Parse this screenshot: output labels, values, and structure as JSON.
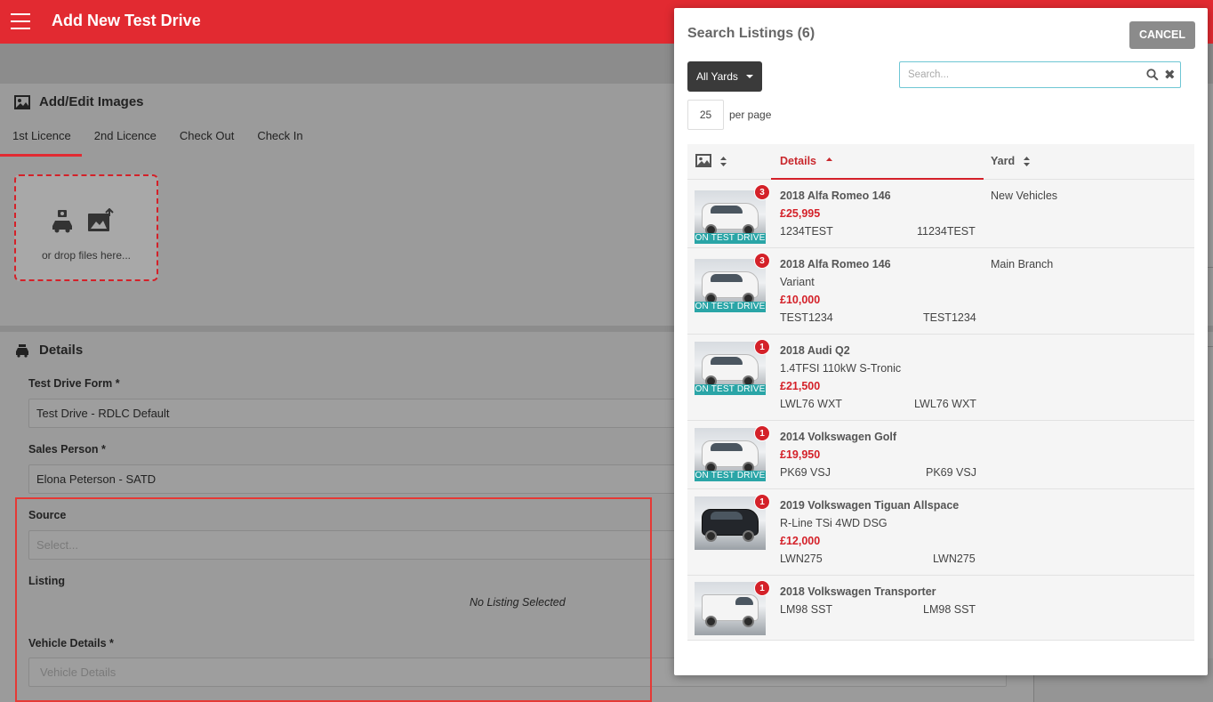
{
  "app": {
    "title": "Add New Test Drive"
  },
  "images_card": {
    "title": "Add/Edit Images",
    "tabs": [
      "1st Licence",
      "2nd Licence",
      "Check Out",
      "Check In"
    ],
    "dropzone_text": "or drop files here..."
  },
  "details_card": {
    "title": "Details",
    "form_label": "Test Drive Form *",
    "form_value": "Test Drive - RDLC Default",
    "sales_label": "Sales Person *",
    "sales_value": "Elona Peterson - SATD",
    "source_label": "Source",
    "source_placeholder": "Select...",
    "listing_label": "Listing",
    "listing_value": "No Listing Selected",
    "vehicle_label": "Vehicle Details *",
    "vehicle_placeholder": "Vehicle Details"
  },
  "modal": {
    "title": "Search Listings (6)",
    "cancel_label": "CANCEL",
    "yards_label": "All Yards",
    "search_placeholder": "Search...",
    "per_page_value": "25",
    "per_page_label": "per page",
    "columns": {
      "details": "Details",
      "yard": "Yard"
    },
    "test_drive_badge": "ON TEST DRIVE",
    "listings": [
      {
        "count": "3",
        "title": "2018 Alfa Romeo 146",
        "variant": "",
        "price": "£25,995",
        "stock": "1234TEST",
        "reg": "11234TEST",
        "yard": "New Vehicles",
        "on_test_drive": true,
        "car_color": "white"
      },
      {
        "count": "3",
        "title": "2018 Alfa Romeo 146",
        "variant": "Variant",
        "price": "£10,000",
        "stock": "TEST1234",
        "reg": "TEST1234",
        "yard": "Main Branch",
        "on_test_drive": true,
        "car_color": "white"
      },
      {
        "count": "1",
        "title": "2018 Audi Q2",
        "variant": "1.4TFSI 110kW S-Tronic",
        "price": "£21,500",
        "stock": "LWL76 WXT",
        "reg": "LWL76 WXT",
        "yard": "",
        "on_test_drive": true,
        "car_color": "white"
      },
      {
        "count": "1",
        "title": "2014 Volkswagen Golf",
        "variant": "",
        "price": "£19,950",
        "stock": "PK69 VSJ",
        "reg": "PK69 VSJ",
        "yard": "",
        "on_test_drive": true,
        "car_color": "white"
      },
      {
        "count": "1",
        "title": "2019 Volkswagen Tiguan Allspace",
        "variant": "R-Line TSi 4WD DSG",
        "price": "£12,000",
        "stock": "LWN275",
        "reg": "LWN275",
        "yard": "",
        "on_test_drive": false,
        "car_color": "black"
      },
      {
        "count": "1",
        "title": "2018 Volkswagen Transporter",
        "variant": "",
        "price": "",
        "stock": "LM98 SST",
        "reg": "LM98 SST",
        "yard": "",
        "on_test_drive": false,
        "car_color": "white"
      }
    ]
  },
  "colors": {
    "brand_red": "#e22a31",
    "price_red": "#d42129",
    "teal_badge": "#2aa5a7"
  }
}
